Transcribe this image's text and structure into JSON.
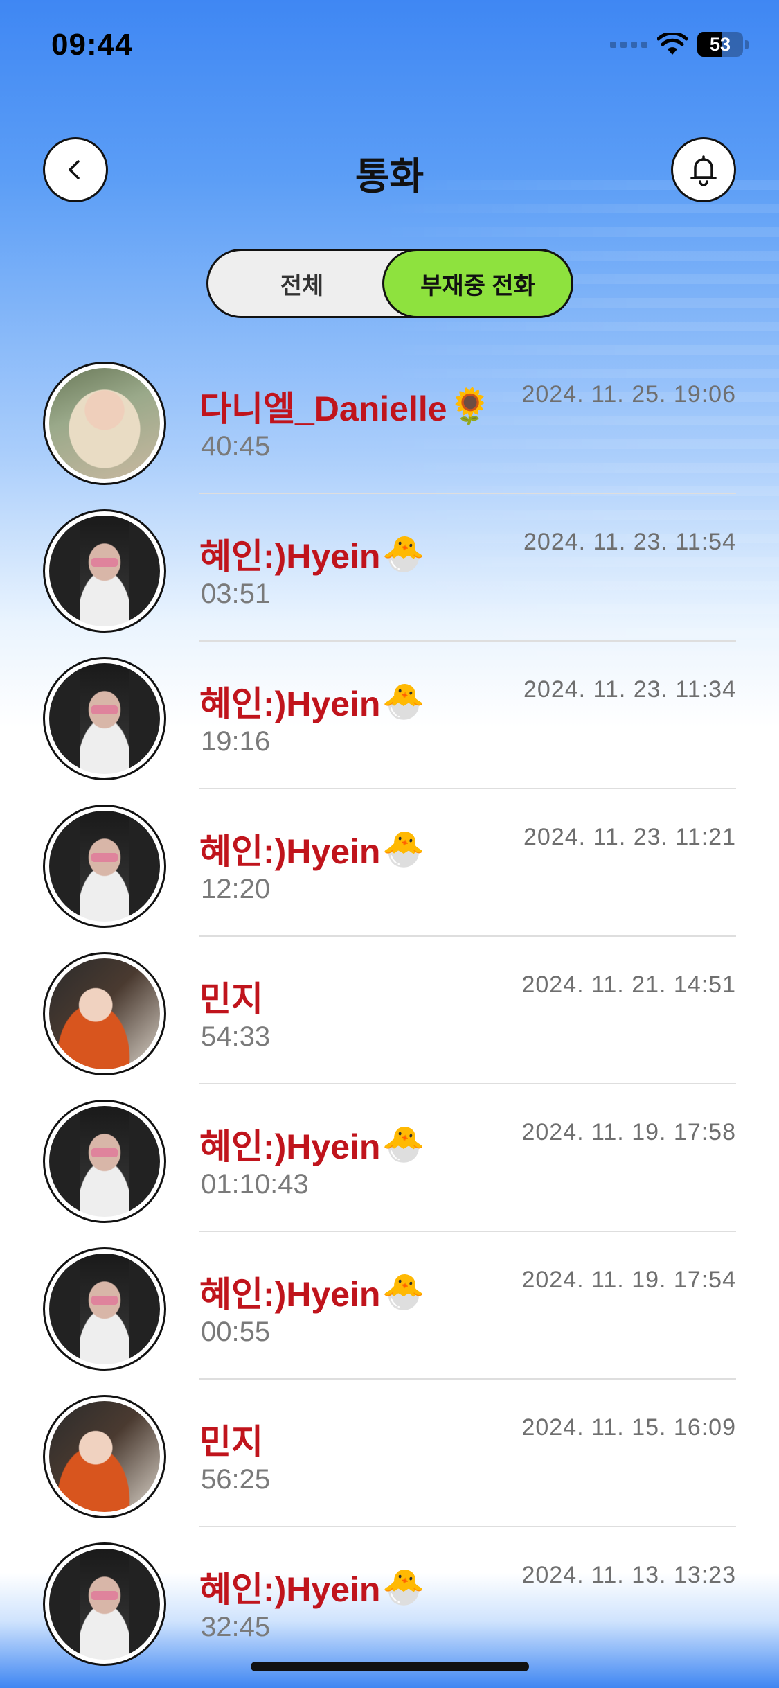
{
  "status_bar": {
    "time": "09:44",
    "battery_percent": 53,
    "battery_label": "53"
  },
  "header": {
    "title": "통화",
    "back_icon": "chevron-left-icon",
    "bell_icon": "bell-icon"
  },
  "segmented": {
    "all_label": "전체",
    "missed_label": "부재중 전화",
    "selected": "missed",
    "selected_color": "#8ee23e"
  },
  "colors": {
    "name_color": "#c0141c",
    "accent_green": "#8ee23e"
  },
  "calls": [
    {
      "name": "다니엘_Danielle",
      "emoji": "🌻",
      "duration": "40:45",
      "date": "2024. 11. 25. 19:06",
      "avatar": "danielle"
    },
    {
      "name": "혜인:)Hyein",
      "emoji": "🐣",
      "duration": "03:51",
      "date": "2024. 11. 23. 11:54",
      "avatar": "hyein"
    },
    {
      "name": "혜인:)Hyein",
      "emoji": "🐣",
      "duration": "19:16",
      "date": "2024. 11. 23. 11:34",
      "avatar": "hyein"
    },
    {
      "name": "혜인:)Hyein",
      "emoji": "🐣",
      "duration": "12:20",
      "date": "2024. 11. 23. 11:21",
      "avatar": "hyein"
    },
    {
      "name": "민지",
      "emoji": "",
      "duration": "54:33",
      "date": "2024. 11. 21. 14:51",
      "avatar": "minji"
    },
    {
      "name": "혜인:)Hyein",
      "emoji": "🐣",
      "duration": "01:10:43",
      "date": "2024. 11. 19. 17:58",
      "avatar": "hyein"
    },
    {
      "name": "혜인:)Hyein",
      "emoji": "🐣",
      "duration": "00:55",
      "date": "2024. 11. 19. 17:54",
      "avatar": "hyein"
    },
    {
      "name": "민지",
      "emoji": "",
      "duration": "56:25",
      "date": "2024. 11. 15. 16:09",
      "avatar": "minji"
    },
    {
      "name": "혜인:)Hyein",
      "emoji": "🐣",
      "duration": "32:45",
      "date": "2024. 11. 13. 13:23",
      "avatar": "hyein"
    }
  ]
}
